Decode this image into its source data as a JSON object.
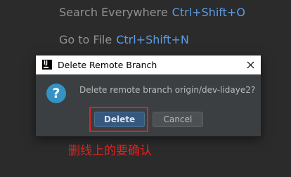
{
  "background_hints": [
    {
      "label": "Search Everywhere",
      "shortcut": "Ctrl+Shift+O"
    },
    {
      "label": "Go to File",
      "shortcut": "Ctrl+Shift+N"
    }
  ],
  "dialog": {
    "title": "Delete Remote Branch",
    "app_icon": "intellij-idea-icon",
    "app_icon_text": "IJ",
    "close_icon": "close-icon",
    "question_icon": "question-icon",
    "question_glyph": "?",
    "message": "Delete remote branch origin/dev-lidaye2?",
    "buttons": {
      "delete": "Delete",
      "cancel": "Cancel"
    }
  },
  "annotation": {
    "text": "删线上的要确认",
    "color": "#e5201f"
  },
  "colors": {
    "background": "#2b2b2b",
    "dialog_background": "#3c3f41",
    "shortcut_blue": "#5a9ce8",
    "primary_button": "#365880",
    "question_icon": "#3592c4"
  }
}
